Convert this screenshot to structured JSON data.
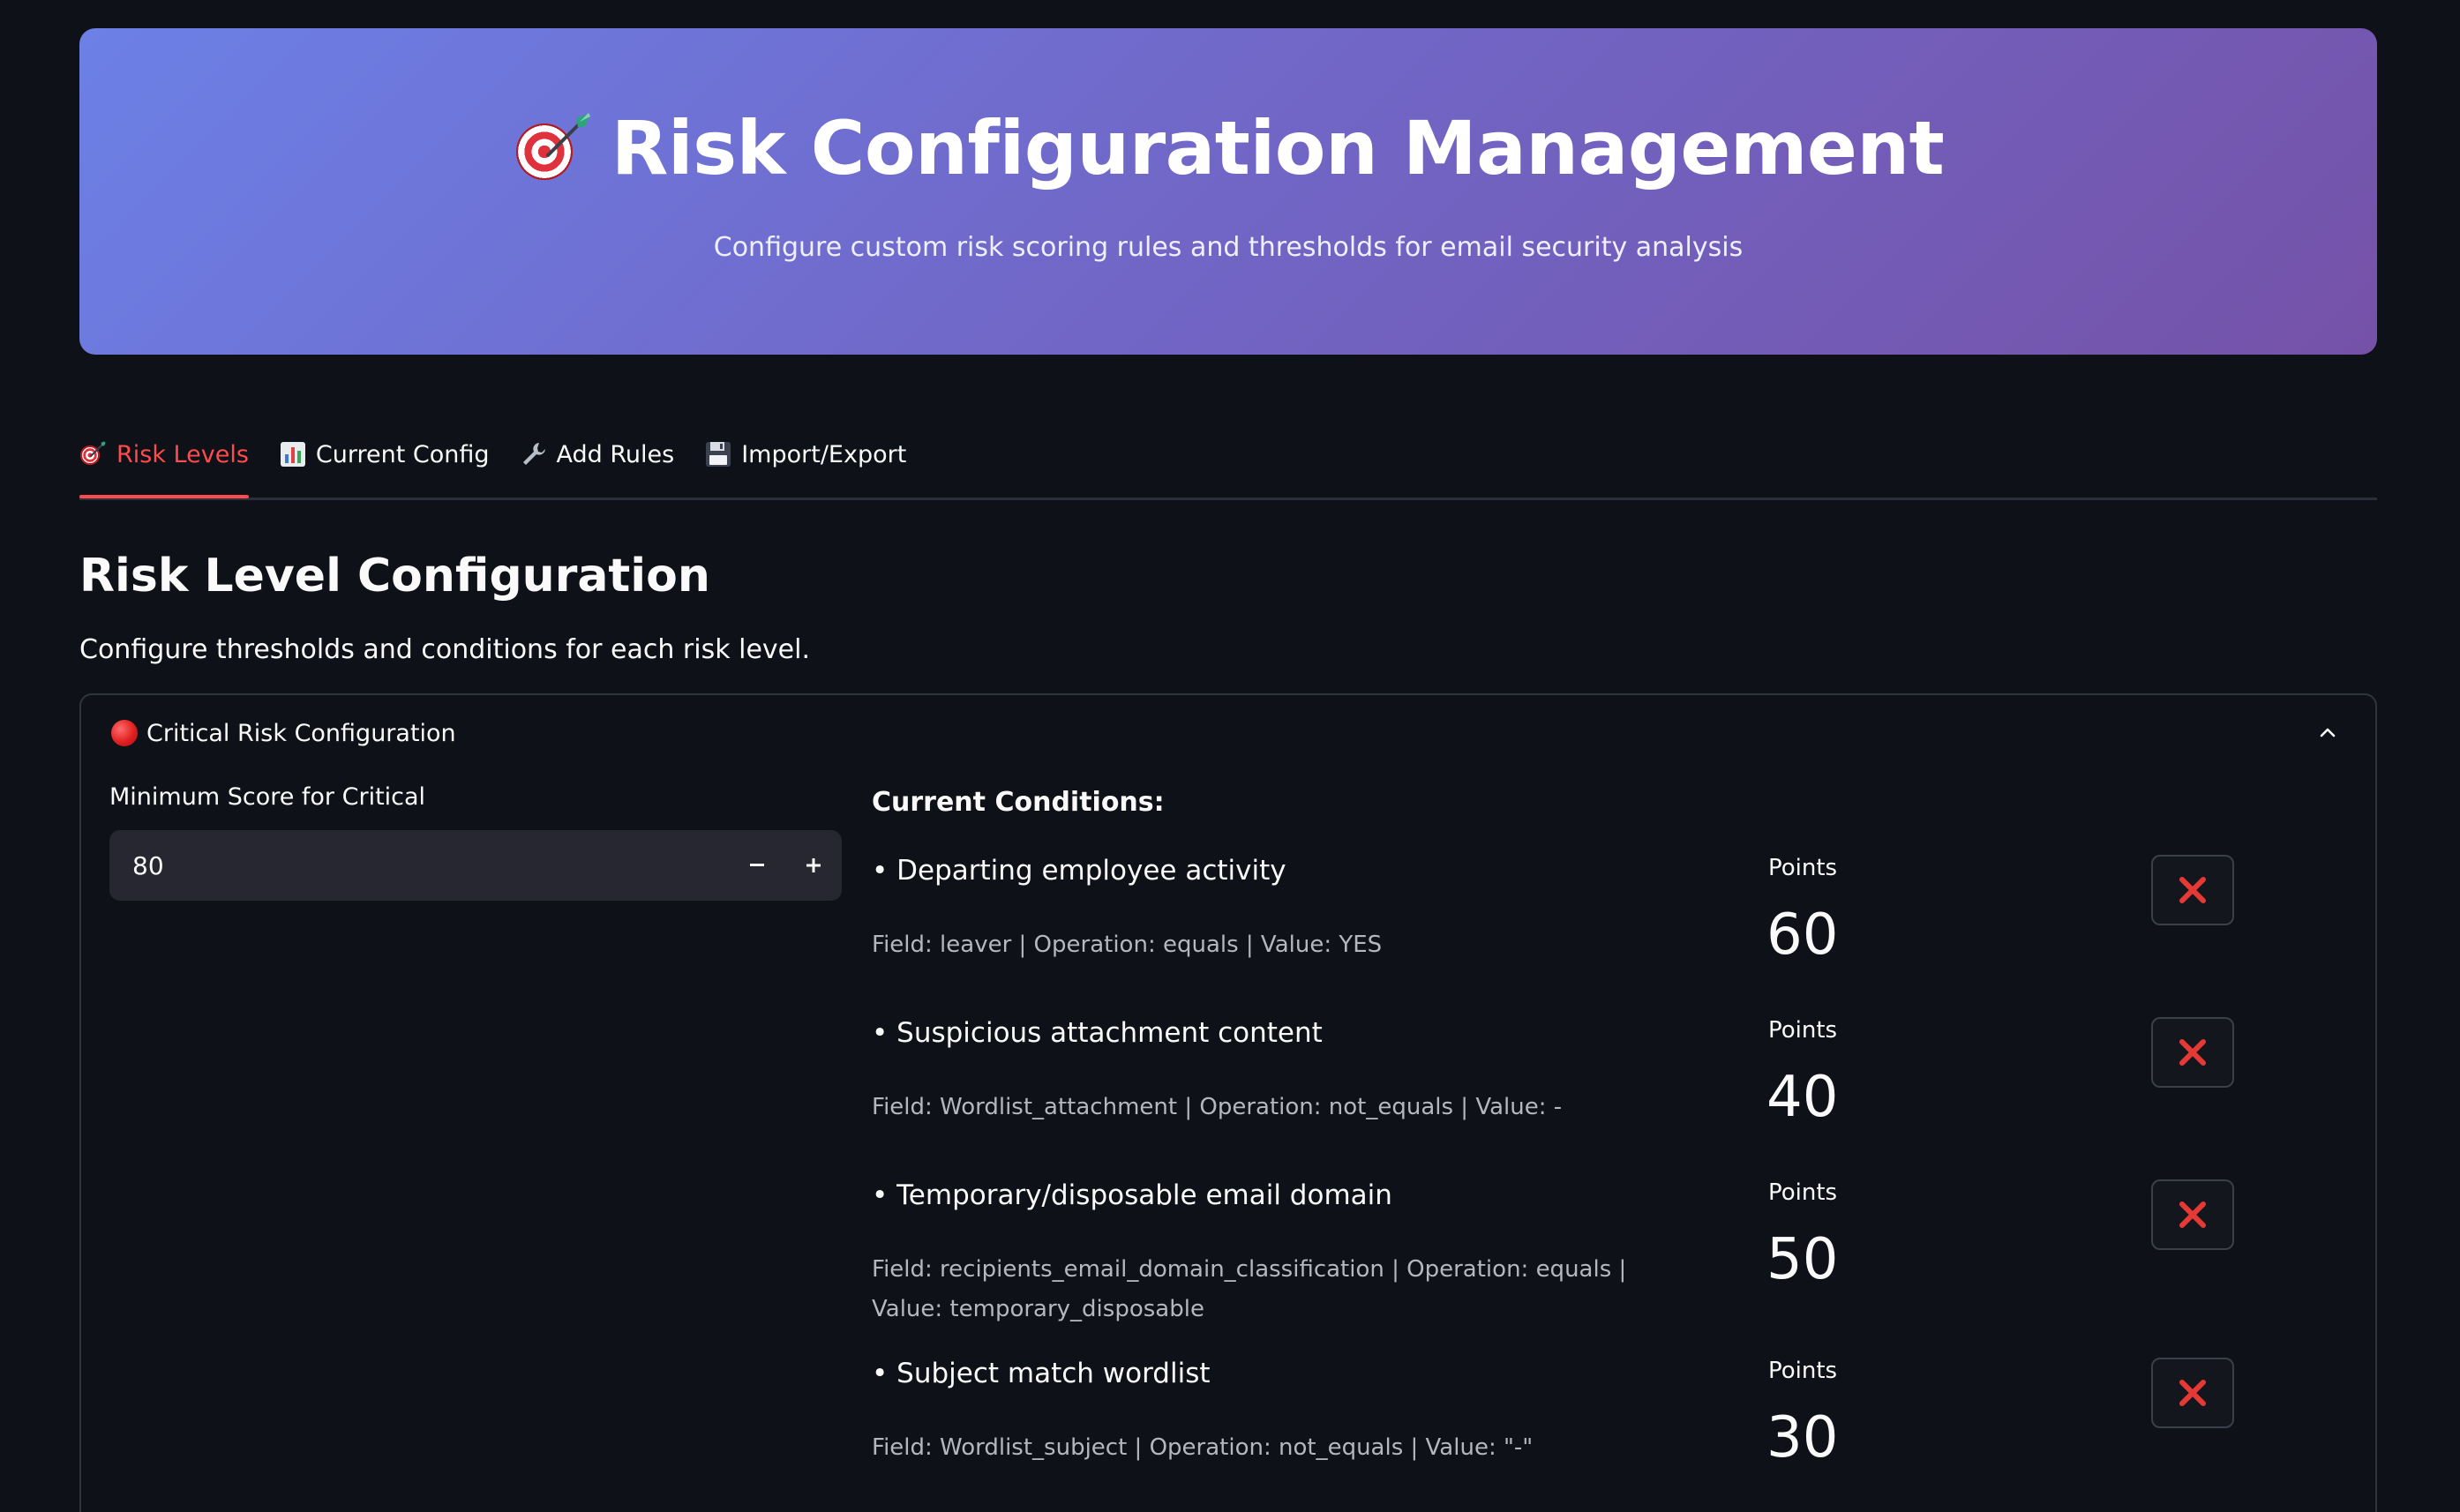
{
  "header": {
    "title": "Risk Configuration Management",
    "subtitle": "Configure custom risk scoring rules and thresholds for email security analysis",
    "icon": "target-dart-icon"
  },
  "tabs": [
    {
      "label": "Risk Levels",
      "icon": "target-dart-icon",
      "active": true
    },
    {
      "label": "Current Config",
      "icon": "bar-chart-icon",
      "active": false
    },
    {
      "label": "Add Rules",
      "icon": "wrench-icon",
      "active": false
    },
    {
      "label": "Import/Export",
      "icon": "floppy-disk-icon",
      "active": false
    }
  ],
  "section": {
    "title": "Risk Level Configuration",
    "description": "Configure thresholds and conditions for each risk level."
  },
  "expander": {
    "label": "Critical Risk Configuration",
    "icon": "red-circle-icon",
    "expanded": true,
    "min_score_label": "Minimum Score for Critical",
    "min_score_value": "80",
    "conditions_title": "Current Conditions:",
    "points_label": "Points",
    "conditions": [
      {
        "name": "• Departing employee activity",
        "detail": "Field: leaver | Operation: equals | Value: YES",
        "points": "60"
      },
      {
        "name": "• Suspicious attachment content",
        "detail": "Field: Wordlist_attachment | Operation: not_equals | Value: -",
        "points": "40"
      },
      {
        "name": "• Temporary/disposable email domain",
        "detail": "Field: recipients_email_domain_classification | Operation: equals | Value: temporary_disposable",
        "points": "50"
      },
      {
        "name": "• Subject match wordlist",
        "detail": "Field: Wordlist_subject | Operation: not_equals | Value: \"-\"",
        "points": "30"
      }
    ]
  },
  "colors": {
    "background": "#0e1117",
    "accent": "#ff4b4b",
    "hero_gradient_start": "#6c80e6",
    "hero_gradient_end": "#7552a8",
    "delete_icon": "#e53935"
  }
}
